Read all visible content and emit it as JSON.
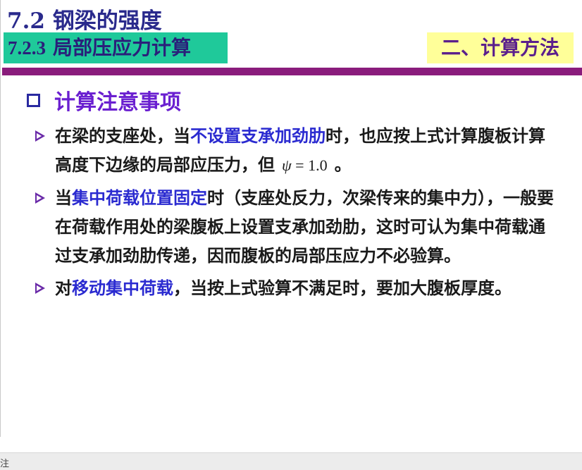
{
  "slide": {
    "title": "7.2 钢梁的强度",
    "section_number": "7.2.3",
    "section_title": "局部压应力计算",
    "method_label": "二、计算方法",
    "heading": "计算注意事项",
    "colors": {
      "section_bg": "#1fc99a",
      "method_bg": "#ffff99",
      "divider": "#8a1c7c",
      "heading": "#6a1fd0",
      "highlight": "#2a2ad0"
    },
    "bullets": [
      {
        "pre": "在梁的支座处，当",
        "highlight": "不设置支承加劲肋",
        "post": "时，也应按上式计算腹板计算高度下边缘的局部应压力，但",
        "formula_symbol": "ψ",
        "formula_rest": " = 1.0",
        "end": "。"
      },
      {
        "pre": "当",
        "highlight": "集中荷载位置固定",
        "post": "时（支座处反力，次梁传来的集中力），一般要在荷载作用处的梁腹板上设置支承加劲肋，这时可认为集中荷载通过支承加劲肋传递，因而腹板的局部压应力不必验算。"
      },
      {
        "pre": "对",
        "highlight": "移动集中荷载",
        "post": "，当按上式验算不满足时，要加大腹板厚度。"
      }
    ]
  },
  "status_bar": {
    "notes_label": "注"
  }
}
